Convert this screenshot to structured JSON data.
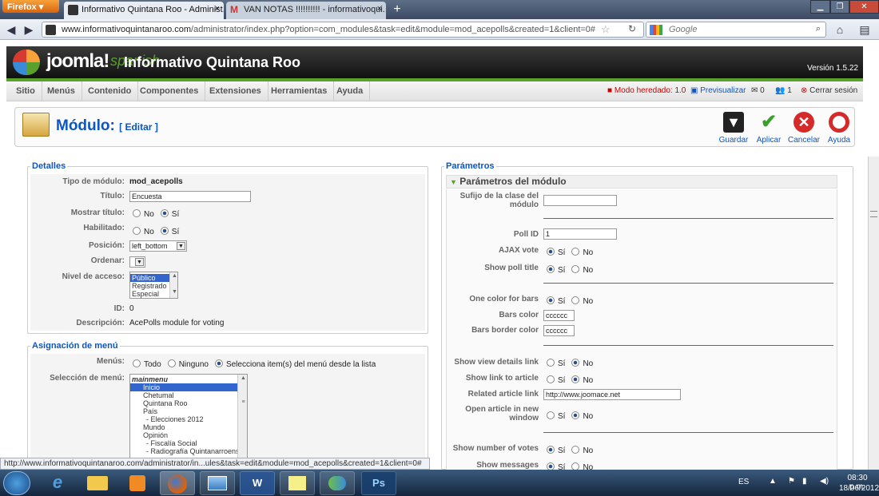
{
  "browser": {
    "ff_button": "Firefox",
    "tab1_title": "Informativo Quintana Roo - Administ...",
    "tab2_title": "VAN NOTAS !!!!!!!!!! - informativoqui...",
    "tab_close": "×",
    "new_tab": "+",
    "url_domain": "www.informativoquintanaroo.com",
    "url_path": "/administrator/index.php?option=com_modules&task=edit&module=mod_acepolls&created=1&client=0#",
    "search_placeholder": "Google",
    "status_url": "http://www.informativoquintanaroo.com/administrator/in...ules&task=edit&module=mod_acepolls&created=1&client=0#"
  },
  "header": {
    "logo": "joomla!",
    "logo_sub": "spanish",
    "site_title": "Informativo Quintana Roo",
    "version": "Versión 1.5.22"
  },
  "menu": {
    "items": [
      "Sitio",
      "Menús",
      "Contenido",
      "Componentes",
      "Extensiones",
      "Herramientas",
      "Ayuda"
    ],
    "legacy_mode": "Modo heredado: 1.0",
    "preview": "Previsualizar",
    "msg_count": "0",
    "users_count": "1",
    "logout": "Cerrar sesión"
  },
  "toolbar": {
    "title": "Módulo:",
    "subtitle": "[ Editar ]",
    "save": "Guardar",
    "apply": "Aplicar",
    "cancel": "Cancelar",
    "help": "Ayuda"
  },
  "details": {
    "legend": "Detalles",
    "type_label": "Tipo de módulo:",
    "type_value": "mod_acepolls",
    "title_label": "Título:",
    "title_value": "Encuesta",
    "show_title_label": "Mostrar título:",
    "enabled_label": "Habilitado:",
    "no": "No",
    "yes": "Sí",
    "position_label": "Posición:",
    "position_value": "left_bottom",
    "order_label": "Ordenar:",
    "access_label": "Nivel de acceso:",
    "access_options": [
      "Público",
      "Registrado",
      "Especial"
    ],
    "id_label": "ID:",
    "id_value": "0",
    "desc_label": "Descripción:",
    "desc_value": "AcePolls module for voting"
  },
  "assignment": {
    "legend": "Asignación de menú",
    "menus_label": "Menús:",
    "opt_all": "Todo",
    "opt_none": "Ninguno",
    "opt_select": "Selecciona item(s) del menú desde la lista",
    "selection_label": "Selección de menú:",
    "menu_items": [
      "mainmenu",
      "Inicio",
      "Chetumal",
      "Quintana Roo",
      "País",
      "- Elecciones 2012",
      "Mundo",
      "Opinión",
      "- Fiscalía Social",
      "- Radiografía Quintanarroense"
    ]
  },
  "params": {
    "legend": "Parámetros",
    "section": "Parámetros del módulo",
    "suffix_label": "Sufijo de la clase del módulo",
    "suffix_value": "",
    "poll_id_label": "Poll ID",
    "poll_id_value": "1",
    "ajax_label": "AJAX vote",
    "show_poll_title_label": "Show poll title",
    "one_color_label": "One color for bars",
    "bars_color_label": "Bars color",
    "bars_color_value": "cccccc",
    "bars_border_label": "Bars border color",
    "bars_border_value": "cccccc",
    "view_details_label": "Show view details link",
    "link_article_label": "Show link to article",
    "related_label": "Related article link",
    "related_value": "http://www.joomace.net",
    "open_new_label": "Open article in new window",
    "num_votes_label": "Show number of votes",
    "messages_label": "Show messages",
    "si": "Sí",
    "no": "No"
  },
  "taskbar": {
    "lang": "ES",
    "time": "08:30 p.m.",
    "date": "18/06/2012",
    "ps": "Ps",
    "word": "W"
  }
}
